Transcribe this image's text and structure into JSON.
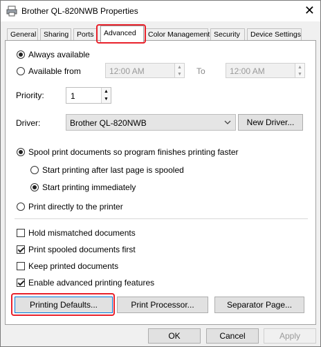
{
  "window": {
    "title": "Brother QL-820NWB Properties",
    "close_glyph": "✕"
  },
  "tabs": [
    "General",
    "Sharing",
    "Ports",
    "Advanced",
    "Color Management",
    "Security",
    "Device Settings"
  ],
  "availability": {
    "always_label": "Always available",
    "from_label": "Available from",
    "from_time": "12:00 AM",
    "to_label": "To",
    "to_time": "12:00 AM"
  },
  "priority": {
    "label": "Priority:",
    "value": "1"
  },
  "driver": {
    "label": "Driver:",
    "value": "Brother QL-820NWB",
    "new_driver_label": "New Driver..."
  },
  "spool": {
    "spool_label": "Spool print documents so program finishes printing faster",
    "after_last_label": "Start printing after last page is spooled",
    "immediately_label": "Start printing immediately",
    "direct_label": "Print directly to the printer"
  },
  "options": {
    "hold_label": "Hold mismatched documents",
    "spooled_first_label": "Print spooled documents first",
    "keep_label": "Keep printed documents",
    "advanced_features_label": "Enable advanced printing features"
  },
  "buttons": {
    "printing_defaults": "Printing Defaults...",
    "print_processor": "Print Processor...",
    "separator_page": "Separator Page...",
    "ok": "OK",
    "cancel": "Cancel",
    "apply": "Apply"
  },
  "colors": {
    "highlight": "#e8202a"
  }
}
